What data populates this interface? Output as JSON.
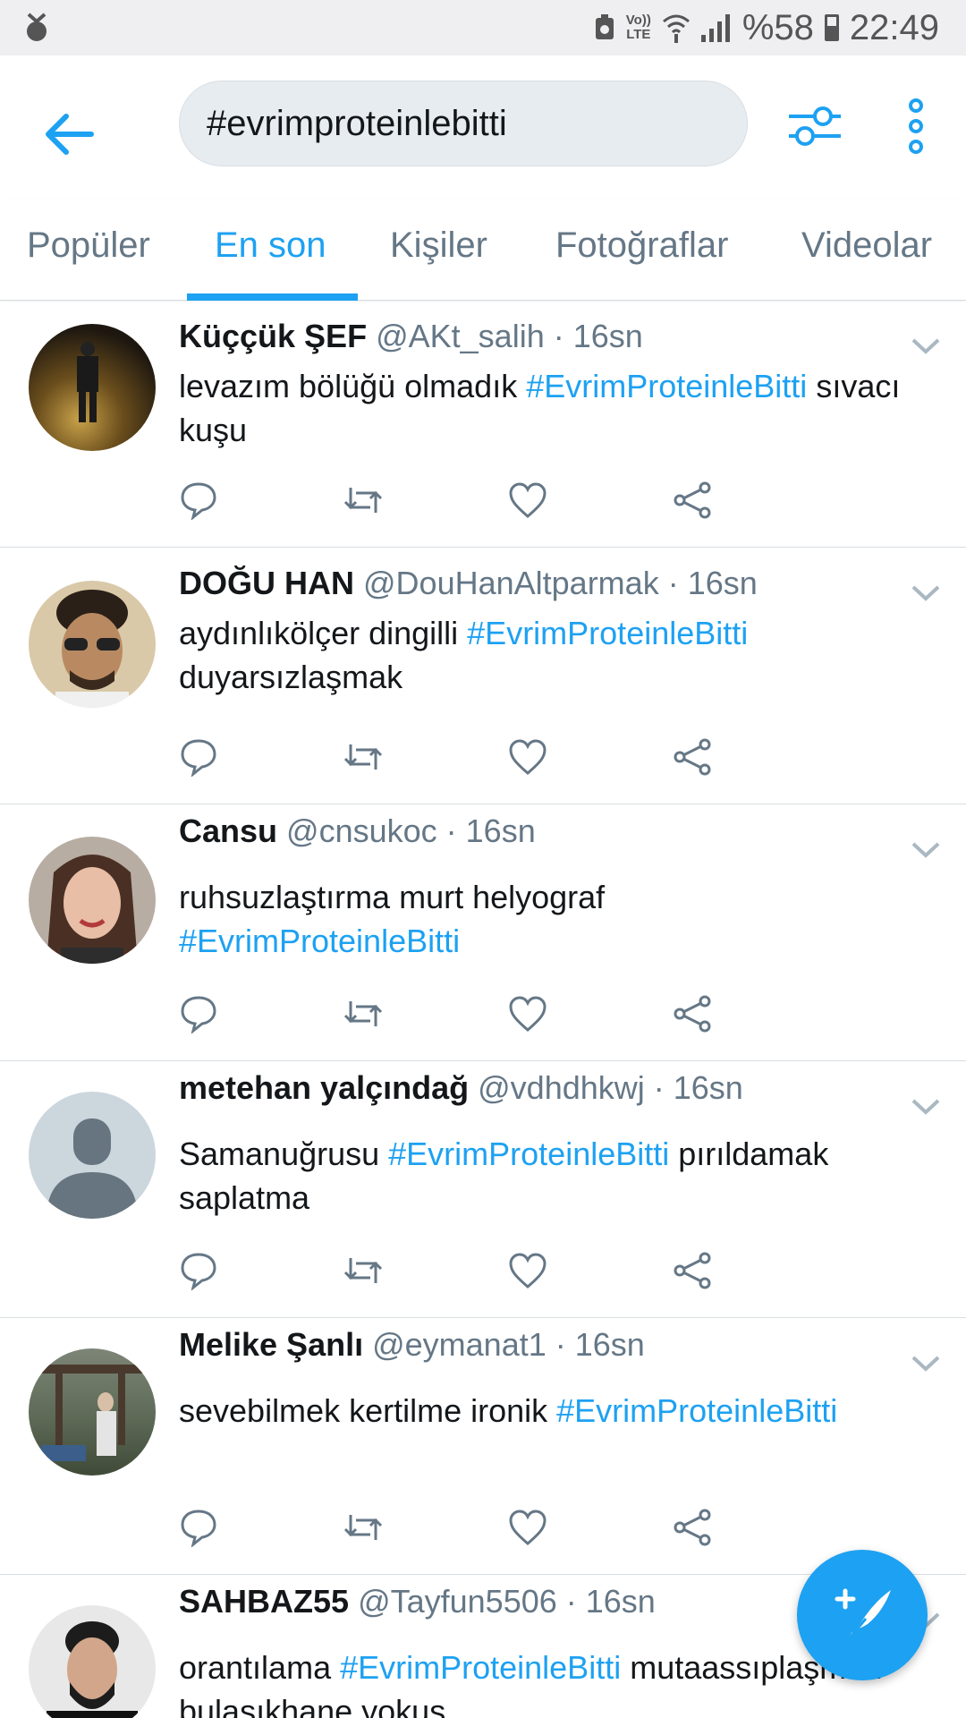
{
  "status_bar": {
    "volte_line1": "Vo))",
    "volte_line2": "LTE",
    "battery_text": "%58",
    "time": "22:49"
  },
  "search": {
    "query": "#evrimproteinlebitti"
  },
  "tabs": [
    {
      "label": "Popüler",
      "active": false
    },
    {
      "label": "En son",
      "active": true
    },
    {
      "label": "Kişiler",
      "active": false
    },
    {
      "label": "Fotoğraflar",
      "active": false
    },
    {
      "label": "Videolar",
      "active": false
    }
  ],
  "tweets": [
    {
      "name": "Küççük ŞEF",
      "handle": "@AKt_salih",
      "time": "16sn",
      "pre": "levazım bölüğü olmadık ",
      "tag": "#EvrimProteinleBitti",
      "post": " sıvacı kuşu"
    },
    {
      "name": "DOĞU HAN",
      "handle": "@DouHanAltparmak",
      "time": "16sn",
      "pre": "aydınlıkölçer dingilli ",
      "tag": "#EvrimProteinleBitti",
      "post": " duyarsızlaşmak"
    },
    {
      "name": "Cansu",
      "handle": "@cnsukoc",
      "time": "16sn",
      "pre": "ruhsuzlaştırma murt helyograf ",
      "tag": "#EvrimProteinleBitti",
      "post": ""
    },
    {
      "name": "metehan yalçındağ",
      "handle": "@vdhdhkwj",
      "time": "16sn",
      "pre": "Samanuğrusu ",
      "tag": "#EvrimProteinleBitti",
      "post": " pırıldamak saplatma"
    },
    {
      "name": "Melike Şanlı",
      "handle": "@eymanat1",
      "time": "16sn",
      "pre": "sevebilmek kertilme ironik ",
      "tag": "#EvrimProteinleBitti",
      "post": ""
    },
    {
      "name": "SAHBAZ55",
      "handle": "@Tayfun5506",
      "time": "16sn",
      "pre": "orantılama ",
      "tag": "#EvrimProteinleBitti",
      "post": " mutaassıplaşmak bulaşıkhane yokuş"
    }
  ],
  "separator": " · ",
  "colors": {
    "accent": "#1da1f2",
    "text": "#14171a",
    "secondary": "#657786"
  },
  "icons": {
    "back": "arrow-left-icon",
    "filter": "sliders-icon",
    "more": "more-vertical-icon",
    "reply": "reply-icon",
    "retweet": "retweet-icon",
    "like": "heart-icon",
    "share": "share-icon",
    "compose": "compose-tweet-icon"
  }
}
